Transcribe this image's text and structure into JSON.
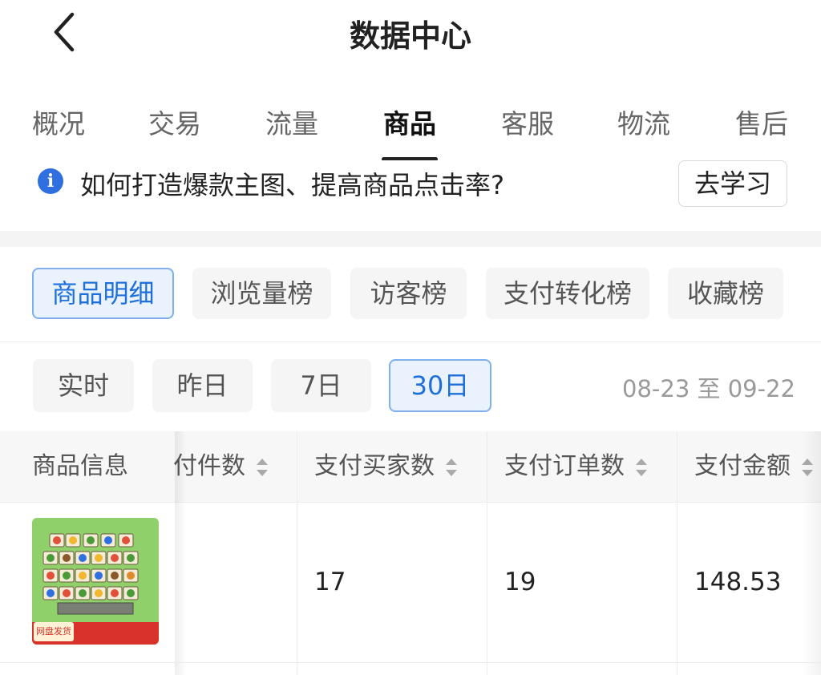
{
  "header": {
    "title": "数据中心"
  },
  "tabs": [
    {
      "label": "概况"
    },
    {
      "label": "交易"
    },
    {
      "label": "流量"
    },
    {
      "label": "商品",
      "active": true
    },
    {
      "label": "客服"
    },
    {
      "label": "物流"
    },
    {
      "label": "售后"
    }
  ],
  "tip": {
    "text": "如何打造爆款主图、提高商品点击率?",
    "button": "去学习"
  },
  "ranks": [
    {
      "label": "商品明细",
      "active": true
    },
    {
      "label": "浏览量榜"
    },
    {
      "label": "访客榜"
    },
    {
      "label": "支付转化榜"
    },
    {
      "label": "收藏榜"
    }
  ],
  "dates": [
    {
      "label": "实时"
    },
    {
      "label": "昨日"
    },
    {
      "label": "7日"
    },
    {
      "label": "30日",
      "active": true
    }
  ],
  "date_range": "08-23 至 09-22",
  "table": {
    "columns": [
      "商品信息",
      "付件数",
      "支付买家数",
      "支付订单数",
      "支付金额"
    ],
    "rows": [
      {
        "buyers": "17",
        "orders": "19",
        "amount": "148.53",
        "thumb_badge": "网盘发货"
      }
    ]
  },
  "colors": {
    "accent": "#1e6fd9",
    "accent_bg": "#eaf2fe",
    "info_icon": "#2f6fe0"
  }
}
